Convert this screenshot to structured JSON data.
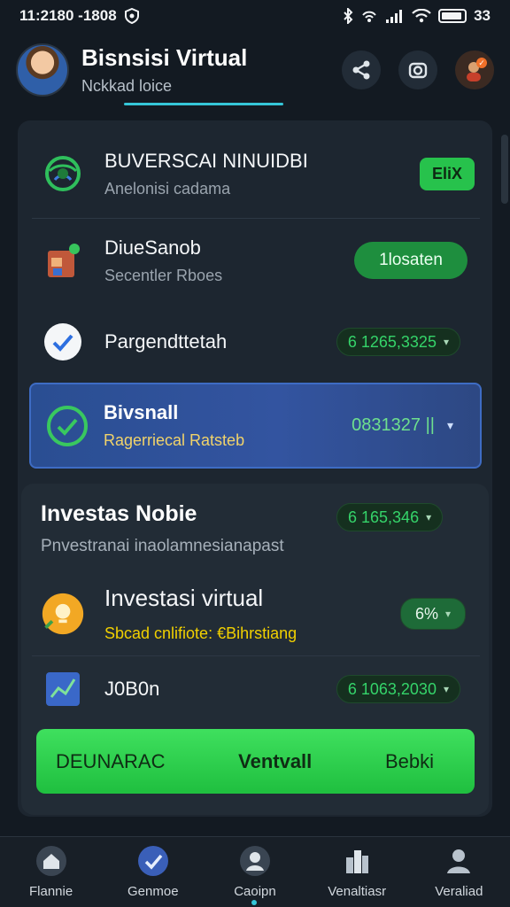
{
  "status_bar": {
    "time": "11:2180 -1808",
    "right_text": "33"
  },
  "header": {
    "title": "Bisnsisi Virtual",
    "subtitle": "Nckkad loice"
  },
  "rows": [
    {
      "title": "BUVERSCAI NINUIDBI",
      "subtitle": "Anelonisi cadama",
      "action": "EliX"
    },
    {
      "title": "DiueSanob",
      "subtitle": "Secentler Rboes",
      "action": "1losaten"
    },
    {
      "title": "Pargendttetah",
      "value": "6 1265,3325"
    },
    {
      "title": "Bivsnall",
      "subtitle": "Ragerriecal Ratsteb",
      "value": "0831327 ||"
    }
  ],
  "section": {
    "title": "Investas Nobie",
    "value": "6 165,346",
    "subtitle": "Pnvestranai inaolamnesianapast",
    "items": [
      {
        "title": "Investasi virtual",
        "subtitle": "Sbcad cnlifiote: €Bihrstiang",
        "value": "6%"
      },
      {
        "title": "J0B0n",
        "value": "6 1063,2030"
      }
    ]
  },
  "cta": {
    "left": "DEUNARAC",
    "center": "Ventvall",
    "right": "Bebki"
  },
  "bottom_nav": [
    {
      "label": "Flannie",
      "icon": "home-icon"
    },
    {
      "label": "Genmoe",
      "icon": "check-circle-icon"
    },
    {
      "label": "Caoipn",
      "icon": "user-face-icon"
    },
    {
      "label": "Venaltiasr",
      "icon": "buildings-icon"
    },
    {
      "label": "Veraliad",
      "icon": "profile-icon"
    }
  ],
  "colors": {
    "background": "#131a22",
    "card": "#1d2630",
    "accent_green": "#27c24c",
    "highlight_blue": "#3354a0",
    "accent_cyan": "#35c6d8"
  }
}
